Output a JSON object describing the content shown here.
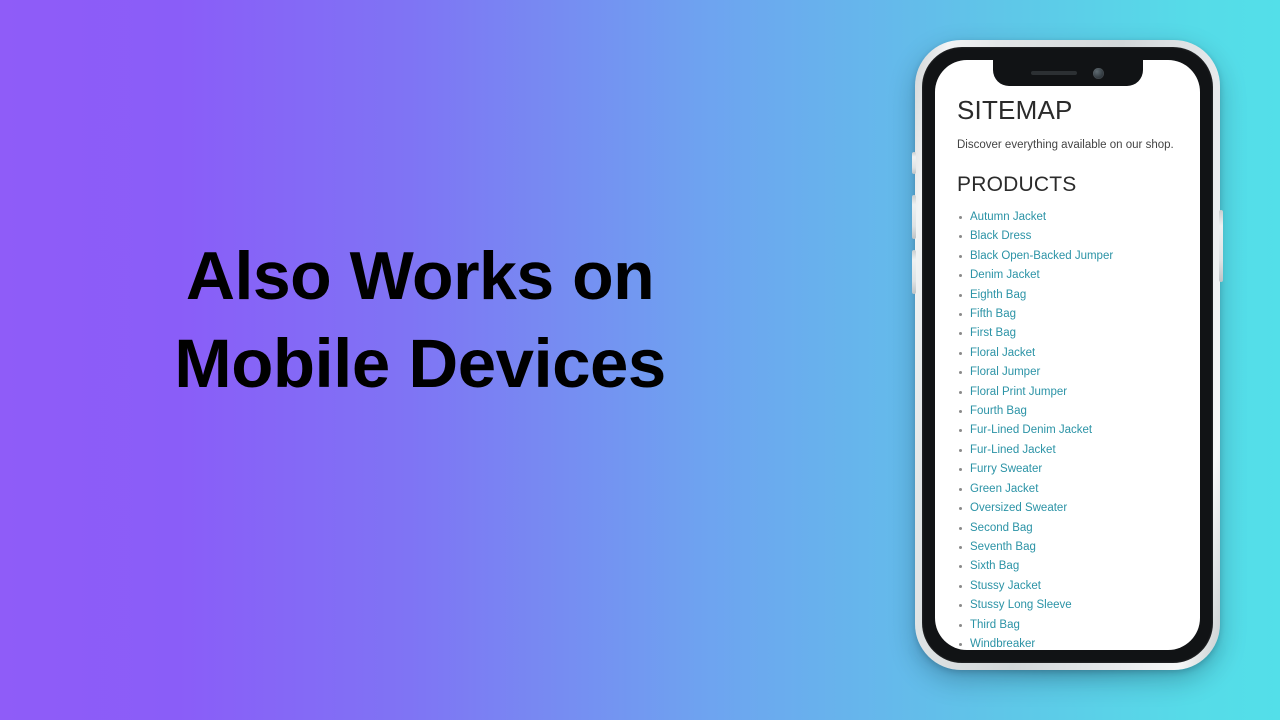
{
  "slide": {
    "headline_line1": "Also Works on",
    "headline_line2": "Mobile Devices",
    "background": {
      "from": "#8f5cf8",
      "mid": "#6ea3f0",
      "to": "#53dfe9",
      "direction": "horizontal-left-to-right"
    }
  },
  "phone": {
    "frame_color": "#dde1e3",
    "bezel_color": "#111315",
    "screen_color": "#ffffff",
    "notch": {
      "speaker_icon": "speaker-grille-icon",
      "camera_icon": "front-camera-icon"
    },
    "buttons": {
      "mute_switch": "mute-switch",
      "volume_up": "volume-up-button",
      "volume_down": "volume-down-button",
      "power": "power-button"
    }
  },
  "screen_page": {
    "title": "SITEMAP",
    "subtitle": "Discover everything available on our shop.",
    "section_title": "PRODUCTS",
    "link_color": "#2b93a6",
    "products": [
      "Autumn Jacket",
      "Black Dress",
      "Black Open-Backed Jumper",
      "Denim Jacket",
      "Eighth Bag",
      "Fifth Bag",
      "First Bag",
      "Floral Jacket",
      "Floral Jumper",
      "Floral Print Jumper",
      "Fourth Bag",
      "Fur-Lined Denim Jacket",
      "Fur-Lined Jacket",
      "Furry Sweater",
      "Green Jacket",
      "Oversized Sweater",
      "Second Bag",
      "Seventh Bag",
      "Sixth Bag",
      "Stussy Jacket",
      "Stussy Long Sleeve",
      "Third Bag",
      "Windbreaker"
    ]
  }
}
